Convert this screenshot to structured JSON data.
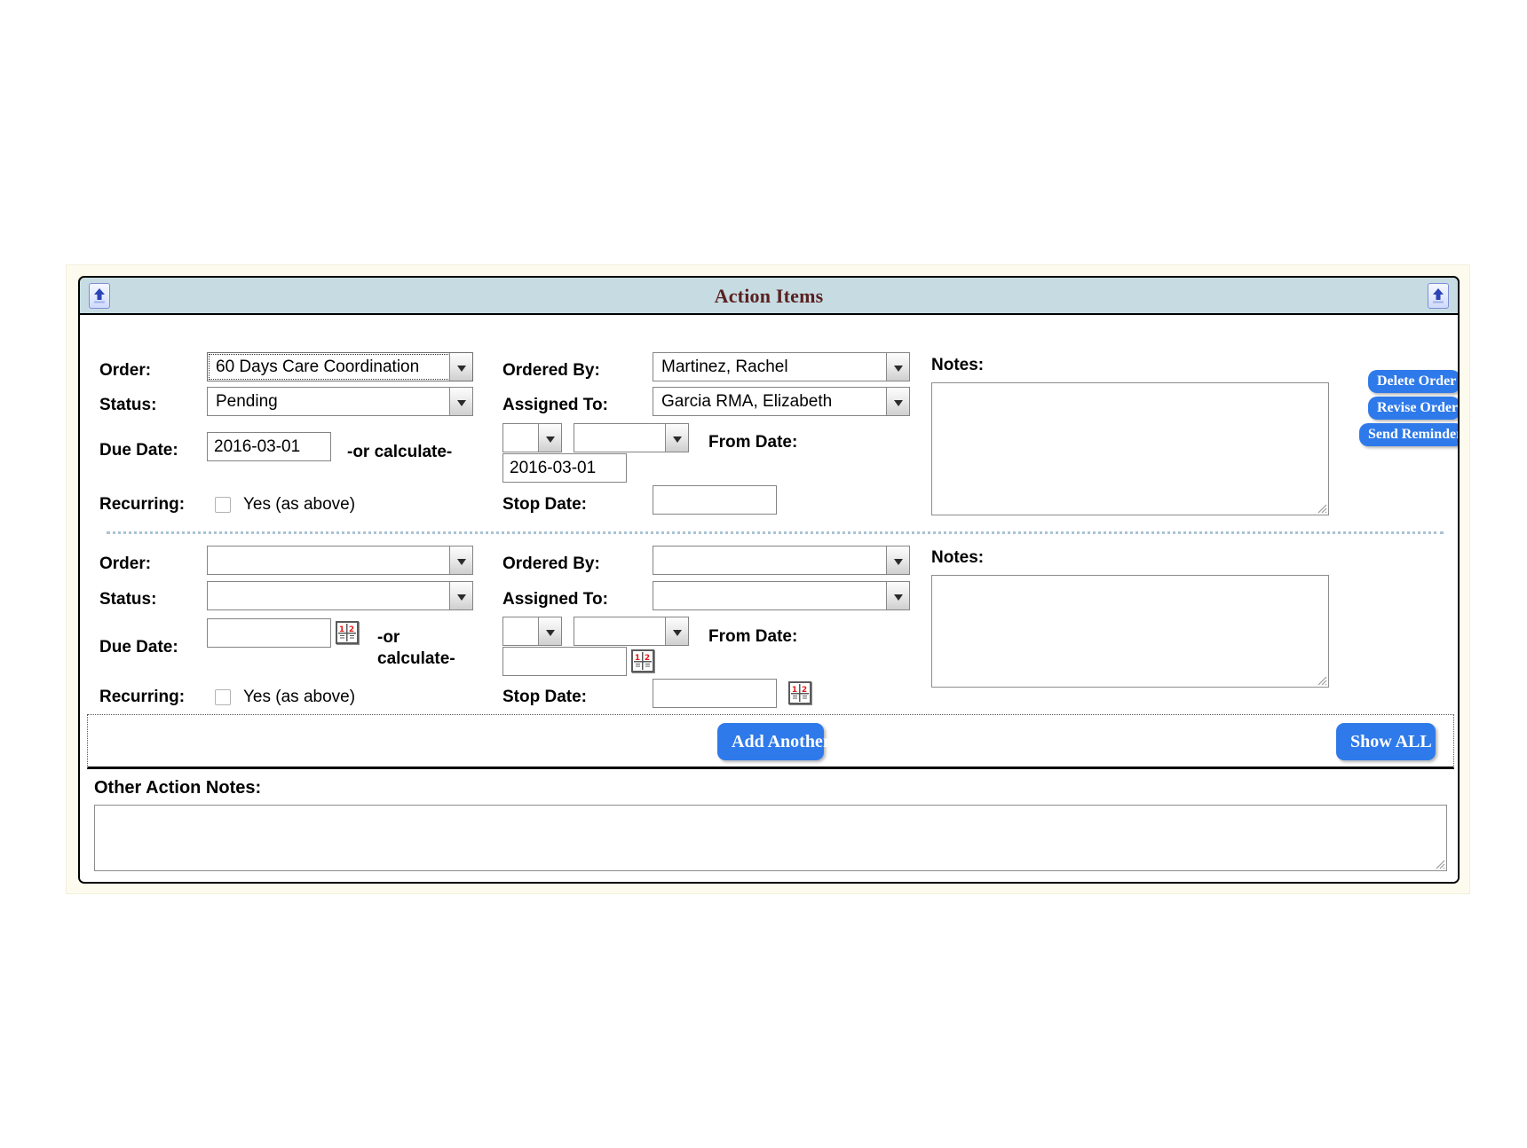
{
  "header": {
    "title": "Action Items",
    "collapse_icon_left": "collapse-up-icon",
    "collapse_icon_right": "collapse-up-icon"
  },
  "labels": {
    "order": "Order:",
    "status": "Status:",
    "due_date": "Due Date:",
    "recurring": "Recurring:",
    "ordered_by": "Ordered By:",
    "assigned_to": "Assigned To:",
    "from_date": "From Date:",
    "stop_date": "Stop Date:",
    "notes": "Notes:",
    "or_calculate": "-or calculate-",
    "or_calculate_wrapped": "-or calculate-",
    "yes_as_above": "Yes (as above)",
    "other_action_notes": "Other Action Notes:"
  },
  "rows": [
    {
      "order_value": "60 Days Care Coordination",
      "status_value": "Pending",
      "due_date_value": "2016-03-01",
      "recurring_checked": false,
      "ordered_by_value": "Martinez, Rachel",
      "assigned_to_value": "Garcia RMA, Elizabeth",
      "calc_number_value": "",
      "calc_unit_value": "",
      "from_date_value": "2016-03-01",
      "stop_date_value": "",
      "notes_value": "",
      "has_calendar_icons": false
    },
    {
      "order_value": "",
      "status_value": "",
      "due_date_value": "",
      "recurring_checked": false,
      "ordered_by_value": "",
      "assigned_to_value": "",
      "calc_number_value": "",
      "calc_unit_value": "",
      "from_date_value": "",
      "stop_date_value": "",
      "notes_value": "",
      "has_calendar_icons": true
    }
  ],
  "order_buttons": {
    "delete": "Delete Order",
    "revise": "Revise Order",
    "remind": "Send Reminder"
  },
  "footer": {
    "add_another": "Add Another",
    "show_all": "Show ALL"
  },
  "other_action_notes_value": "",
  "colors": {
    "header_bg": "#c6dce2",
    "title_text": "#5a1f1f",
    "button_blue": "#2f7aea",
    "frame_cream": "#fdfbee",
    "separator_blue": "#a9c3d4",
    "calendar_red": "#e01b1b"
  }
}
